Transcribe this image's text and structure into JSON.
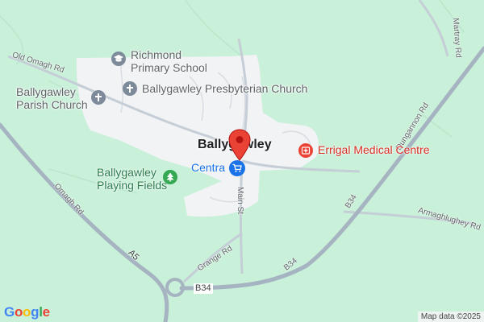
{
  "map": {
    "colors": {
      "land": "#c9f0d9",
      "urban": "#f1f3f4",
      "major_road": "#a6b4c2",
      "minor_road": "#c5ced6",
      "marker": "#ea4335",
      "shop": "#1a73e8",
      "medical": "#ea4335",
      "park": "#34a853",
      "worship": "#7c8a99"
    },
    "town_label": "Ballygawley",
    "pois": {
      "school": {
        "label": "Richmond\nPrimary School",
        "icon": "school-icon"
      },
      "presbyterian": {
        "label": "Ballygawley Presbyterian Church",
        "icon": "church-icon"
      },
      "parish": {
        "label": "Ballygawley\nParish Church",
        "icon": "church-icon"
      },
      "medical": {
        "label": "Errigal Medical Centre",
        "icon": "medical-icon"
      },
      "shop": {
        "label": "Centra",
        "icon": "shopping-cart-icon"
      },
      "playing_fields": {
        "label": "Ballygawley\nPlaying Fields",
        "icon": "tree-icon"
      }
    },
    "roads": {
      "old_omagh": "Old Omagh Rd",
      "omagh": "Omagh Rd",
      "a5": "A5",
      "main_st": "Main St",
      "grange": "Grange Rd",
      "b34_south": "B34",
      "b34_east": "B34",
      "b34_diag": "B34",
      "dungannon": "Dungannon Rd",
      "armaghlughey": "Armaghlughey Rd",
      "martray": "Martray Rd"
    },
    "logo": "Google",
    "attribution": "Map data ©2025"
  }
}
